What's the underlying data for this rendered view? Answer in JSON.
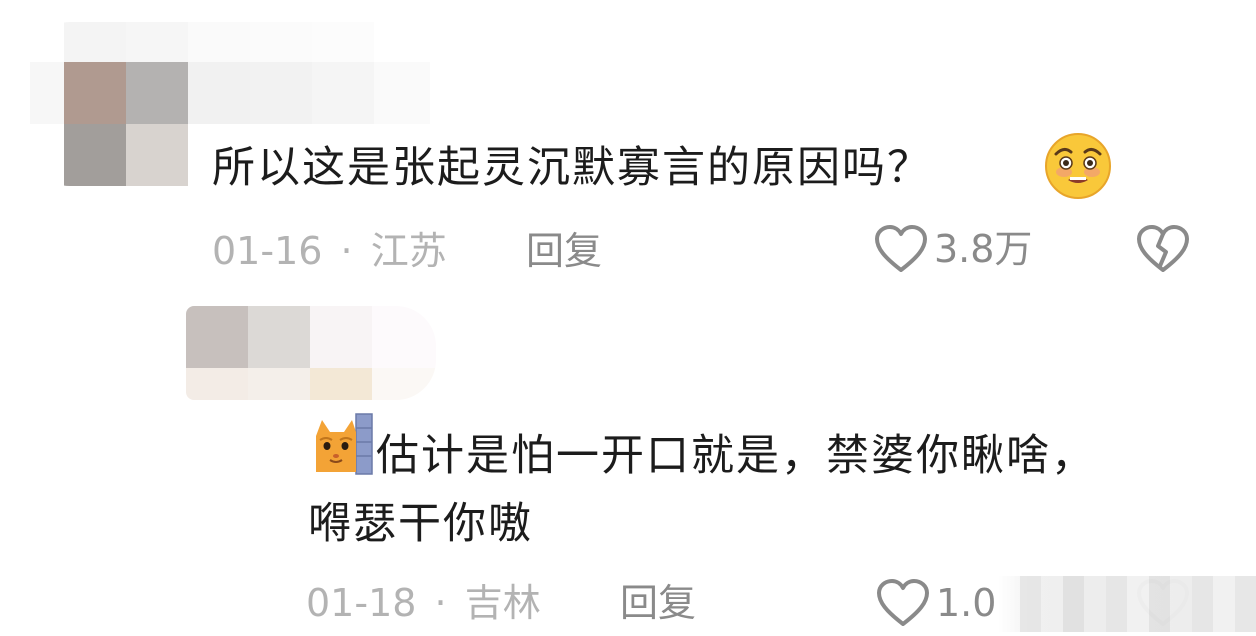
{
  "comments": [
    {
      "text": "所以这是张起灵沉默寡言的原因吗？",
      "date": "01-16",
      "sep": "·",
      "region": "江苏",
      "reply_label": "回复",
      "likes": "3.8万",
      "emoji": "woozy-face-icon"
    },
    {
      "line1": "估计是怕一开口就是，禁婆你瞅啥，",
      "line2": "嘚瑟干你嗷",
      "date": "01-18",
      "sep": "·",
      "region": "吉林",
      "reply_label": "回复",
      "likes": "1.0",
      "emoji": "peeking-cat-icon"
    }
  ],
  "colors": {
    "text": "#1c1c1c",
    "meta": "#b3b3b3",
    "action": "#8a8a8a"
  }
}
